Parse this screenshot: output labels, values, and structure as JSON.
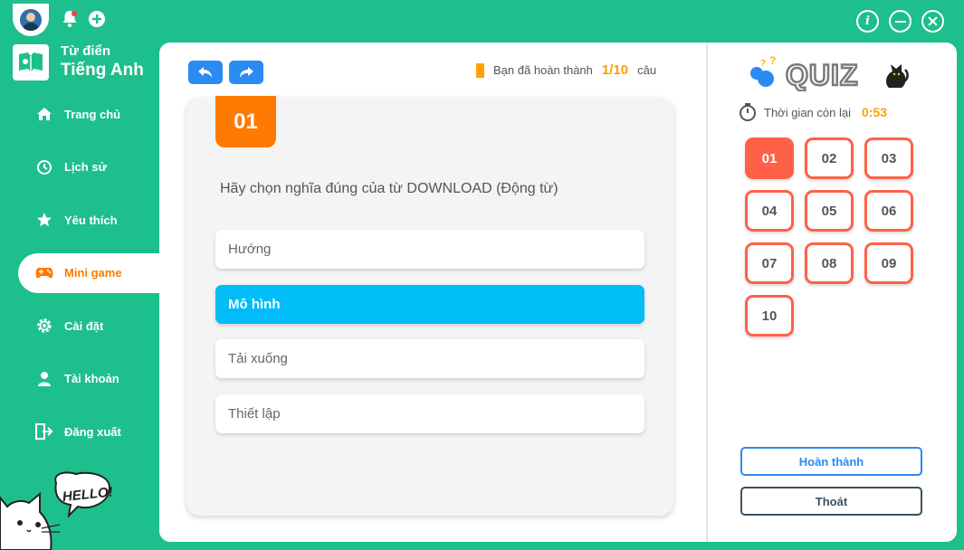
{
  "app": {
    "brand_line1": "Từ điển",
    "brand_line2": "Tiếng Anh"
  },
  "sidebar": {
    "items": [
      {
        "label": "Trang chủ",
        "icon": "home-icon"
      },
      {
        "label": "Lịch sử",
        "icon": "history-icon"
      },
      {
        "label": "Yêu thích",
        "icon": "star-icon"
      },
      {
        "label": "Mini game",
        "icon": "gamepad-icon",
        "active": true
      },
      {
        "label": "Cài đặt",
        "icon": "gear-icon"
      },
      {
        "label": "Tài khoản",
        "icon": "user-icon"
      },
      {
        "label": "Đăng xuất",
        "icon": "logout-icon"
      }
    ],
    "mascot_text": "HELLO!"
  },
  "quiz": {
    "progress_label": "Bạn đã hoàn thành",
    "progress_value": "1/10",
    "progress_unit": "câu",
    "question_number": "01",
    "question_text": "Hãy chọn nghĩa đúng của từ DOWNLOAD (Động từ)",
    "options": [
      {
        "label": "Hướng",
        "selected": false
      },
      {
        "label": "Mô hình",
        "selected": true
      },
      {
        "label": "Tải xuống",
        "selected": false
      },
      {
        "label": "Thiết lập",
        "selected": false
      }
    ],
    "logo_text": "QUIZ",
    "timer_label": "Thời gian còn lại",
    "timer_value": "0:53",
    "question_numbers": [
      "01",
      "02",
      "03",
      "04",
      "05",
      "06",
      "07",
      "08",
      "09",
      "10"
    ],
    "current_question": "01",
    "finish_label": "Hoàn thành",
    "exit_label": "Thoát"
  },
  "colors": {
    "primary": "#1dbf8c",
    "accent_orange": "#ff7a00",
    "selected_blue": "#00bdf7",
    "question_red": "#ff6148",
    "button_blue": "#2a8bf2"
  }
}
